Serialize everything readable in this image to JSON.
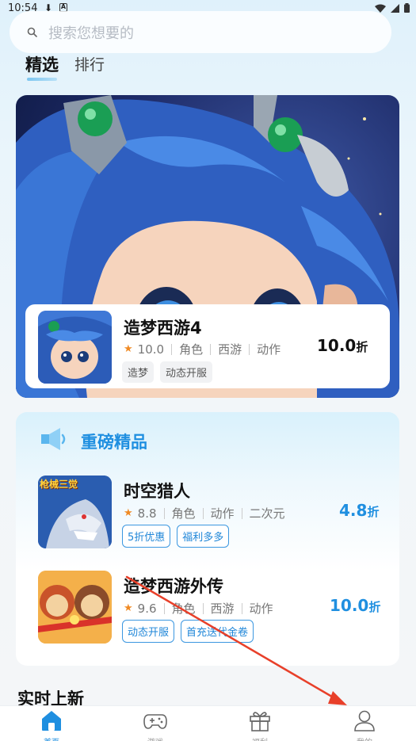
{
  "status_bar": {
    "time": "10:54"
  },
  "search": {
    "placeholder": "搜索您想要的"
  },
  "tabs": [
    {
      "label": "精选"
    },
    {
      "label": "排行"
    }
  ],
  "featured": {
    "title": "造梦西游4",
    "rating": "10.0",
    "genres": [
      "角色",
      "西游",
      "动作"
    ],
    "tags": [
      "造梦",
      "动态开服"
    ],
    "discount_value": "10.0",
    "discount_unit": "折"
  },
  "section": {
    "title": "重磅精品",
    "items": [
      {
        "title": "时空猎人",
        "rating": "8.8",
        "genres": [
          "角色",
          "动作",
          "二次元"
        ],
        "tags": [
          "5折优惠",
          "福利多多"
        ],
        "discount_value": "4.8",
        "discount_unit": "折",
        "thumb_text": "枪械三觉"
      },
      {
        "title": "造梦西游外传",
        "rating": "9.6",
        "genres": [
          "角色",
          "西游",
          "动作"
        ],
        "tags": [
          "动态开服",
          "首充送代金卷"
        ],
        "discount_value": "10.0",
        "discount_unit": "折"
      }
    ]
  },
  "new_section": {
    "title": "实时上新"
  },
  "bottom_nav": [
    {
      "label": "首页",
      "icon": "home-icon",
      "active": true
    },
    {
      "label": "游戏",
      "icon": "gamepad-icon",
      "active": false
    },
    {
      "label": "福利",
      "icon": "gift-icon",
      "active": false
    },
    {
      "label": "我的",
      "icon": "user-icon",
      "active": false
    }
  ],
  "colors": {
    "accent": "#1f8fe0",
    "star": "#f08a24",
    "annotation_arrow": "#e8402a"
  }
}
